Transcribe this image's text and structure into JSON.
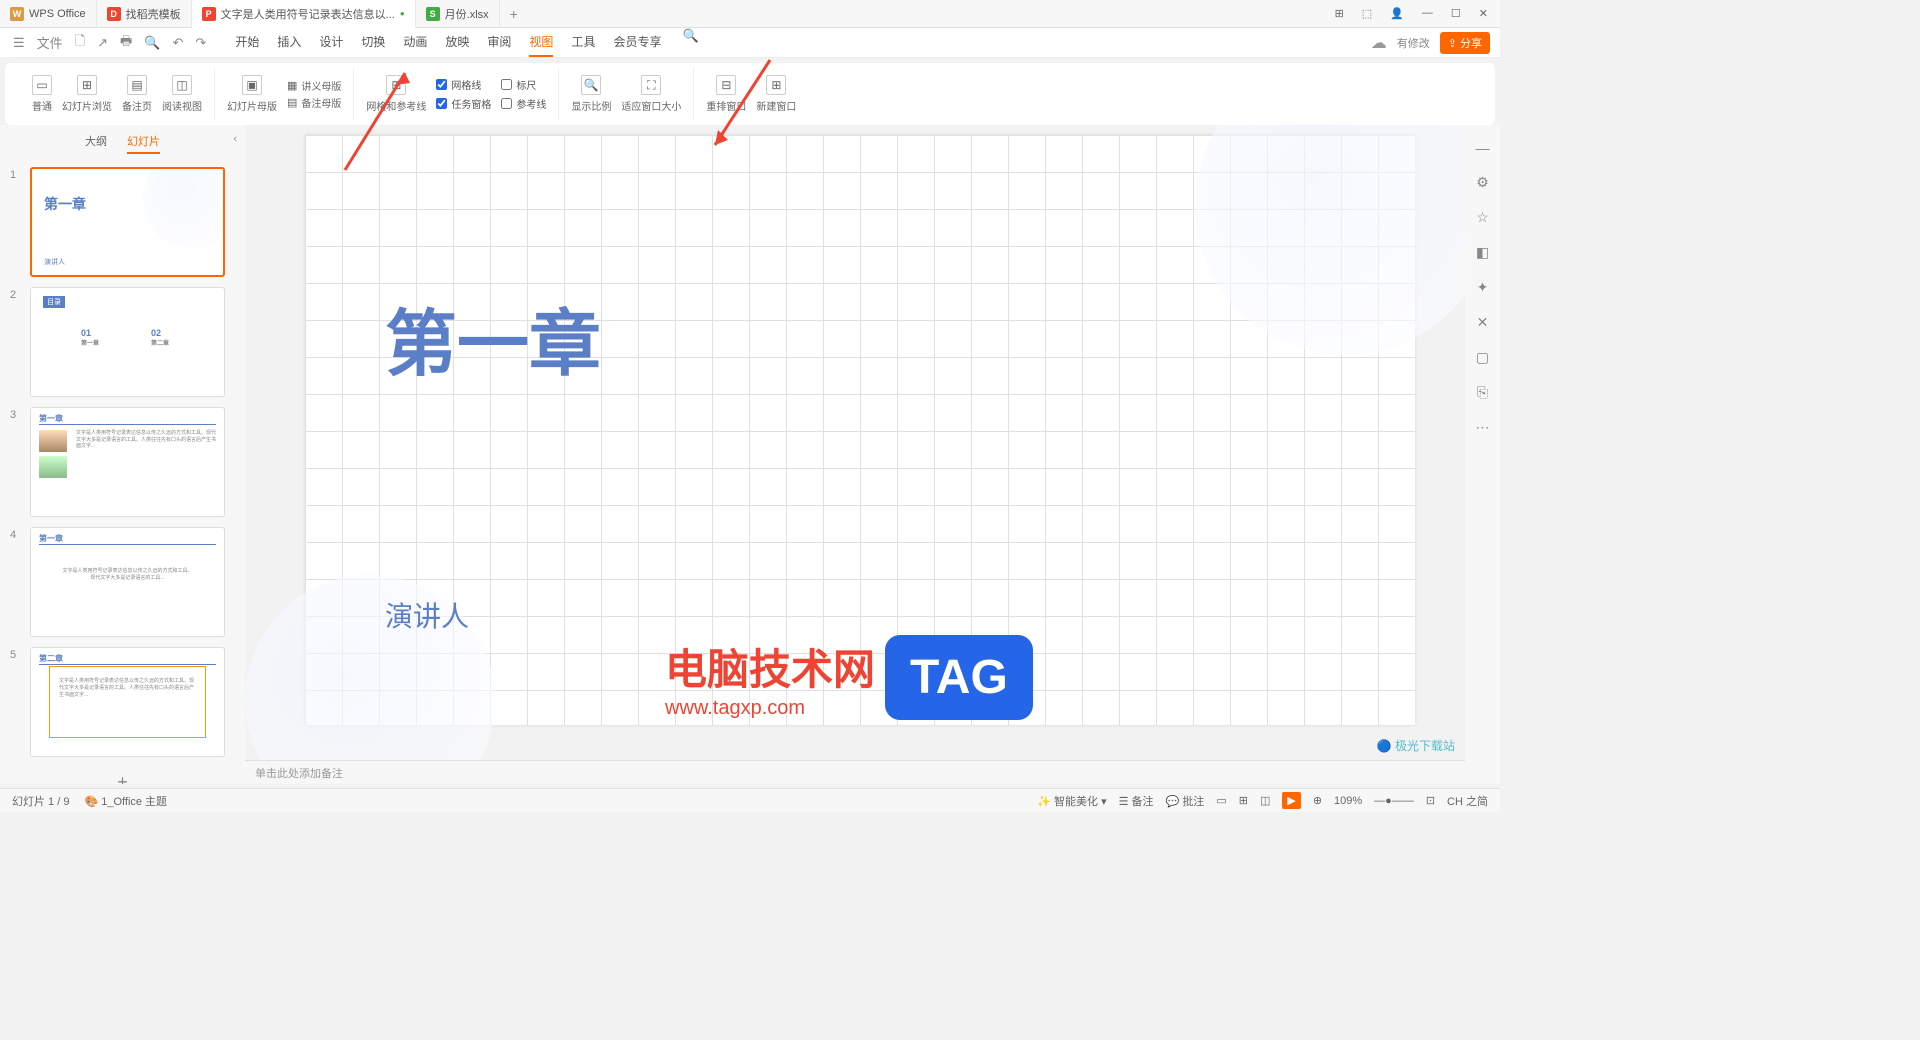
{
  "tabs": [
    {
      "icon": "W",
      "iconBg": "#d94",
      "label": "WPS Office"
    },
    {
      "icon": "D",
      "iconBg": "#e43",
      "label": "找稻壳模板"
    },
    {
      "icon": "P",
      "iconBg": "#e43",
      "label": "文字是人类用符号记录表达信息以..."
    },
    {
      "icon": "S",
      "iconBg": "#4a4",
      "label": "月份.xlsx"
    }
  ],
  "fileMenu": "文件",
  "menuTabs": [
    "开始",
    "插入",
    "设计",
    "切换",
    "动画",
    "放映",
    "审阅",
    "视图",
    "工具",
    "会员专享"
  ],
  "activeMenu": "视图",
  "modifyText": "有修改",
  "shareBtn": "分享",
  "ribbon": {
    "group1": [
      {
        "label": "普通"
      },
      {
        "label": "幻灯片浏览"
      },
      {
        "label": "备注页"
      },
      {
        "label": "阅读视图"
      }
    ],
    "group2": [
      {
        "label": "幻灯片母版"
      },
      {
        "label": "讲义母版"
      },
      {
        "label": "备注母版"
      }
    ],
    "group3Label": "网格和参考线",
    "checks": [
      {
        "label": "网格线",
        "checked": true
      },
      {
        "label": "任务窗格",
        "checked": true
      },
      {
        "label": "标尺",
        "checked": false
      },
      {
        "label": "参考线",
        "checked": false
      }
    ],
    "group4": [
      {
        "label": "显示比例"
      },
      {
        "label": "适应窗口大小"
      }
    ],
    "group5": [
      {
        "label": "重排窗口"
      },
      {
        "label": "新建窗口"
      }
    ]
  },
  "thumbTabs": {
    "outline": "大纲",
    "slides": "幻灯片"
  },
  "slides": {
    "s1": {
      "title": "第一章",
      "sub": "演讲人"
    },
    "s2": {
      "head": "目录",
      "c1": "01",
      "c1s": "第一章",
      "c2": "02",
      "c2s": "第二章"
    },
    "s3": {
      "head": "第一章"
    },
    "s4": {
      "head": "第一章"
    },
    "s5": {
      "head": "第二章"
    }
  },
  "mainSlide": {
    "title": "第一章",
    "sub": "演讲人"
  },
  "notesPlaceholder": "单击此处添加备注",
  "watermark": {
    "text": "电脑技术网",
    "url": "www.tagxp.com",
    "tag": "TAG"
  },
  "jgLogo": "极光下载站",
  "status": {
    "left": "幻灯片 1 / 9",
    "theme": "1_Office 主题",
    "beautify": "智能美化",
    "notes": "备注",
    "comments": "批注",
    "zoom": "109%",
    "ime": "CH 之简"
  }
}
